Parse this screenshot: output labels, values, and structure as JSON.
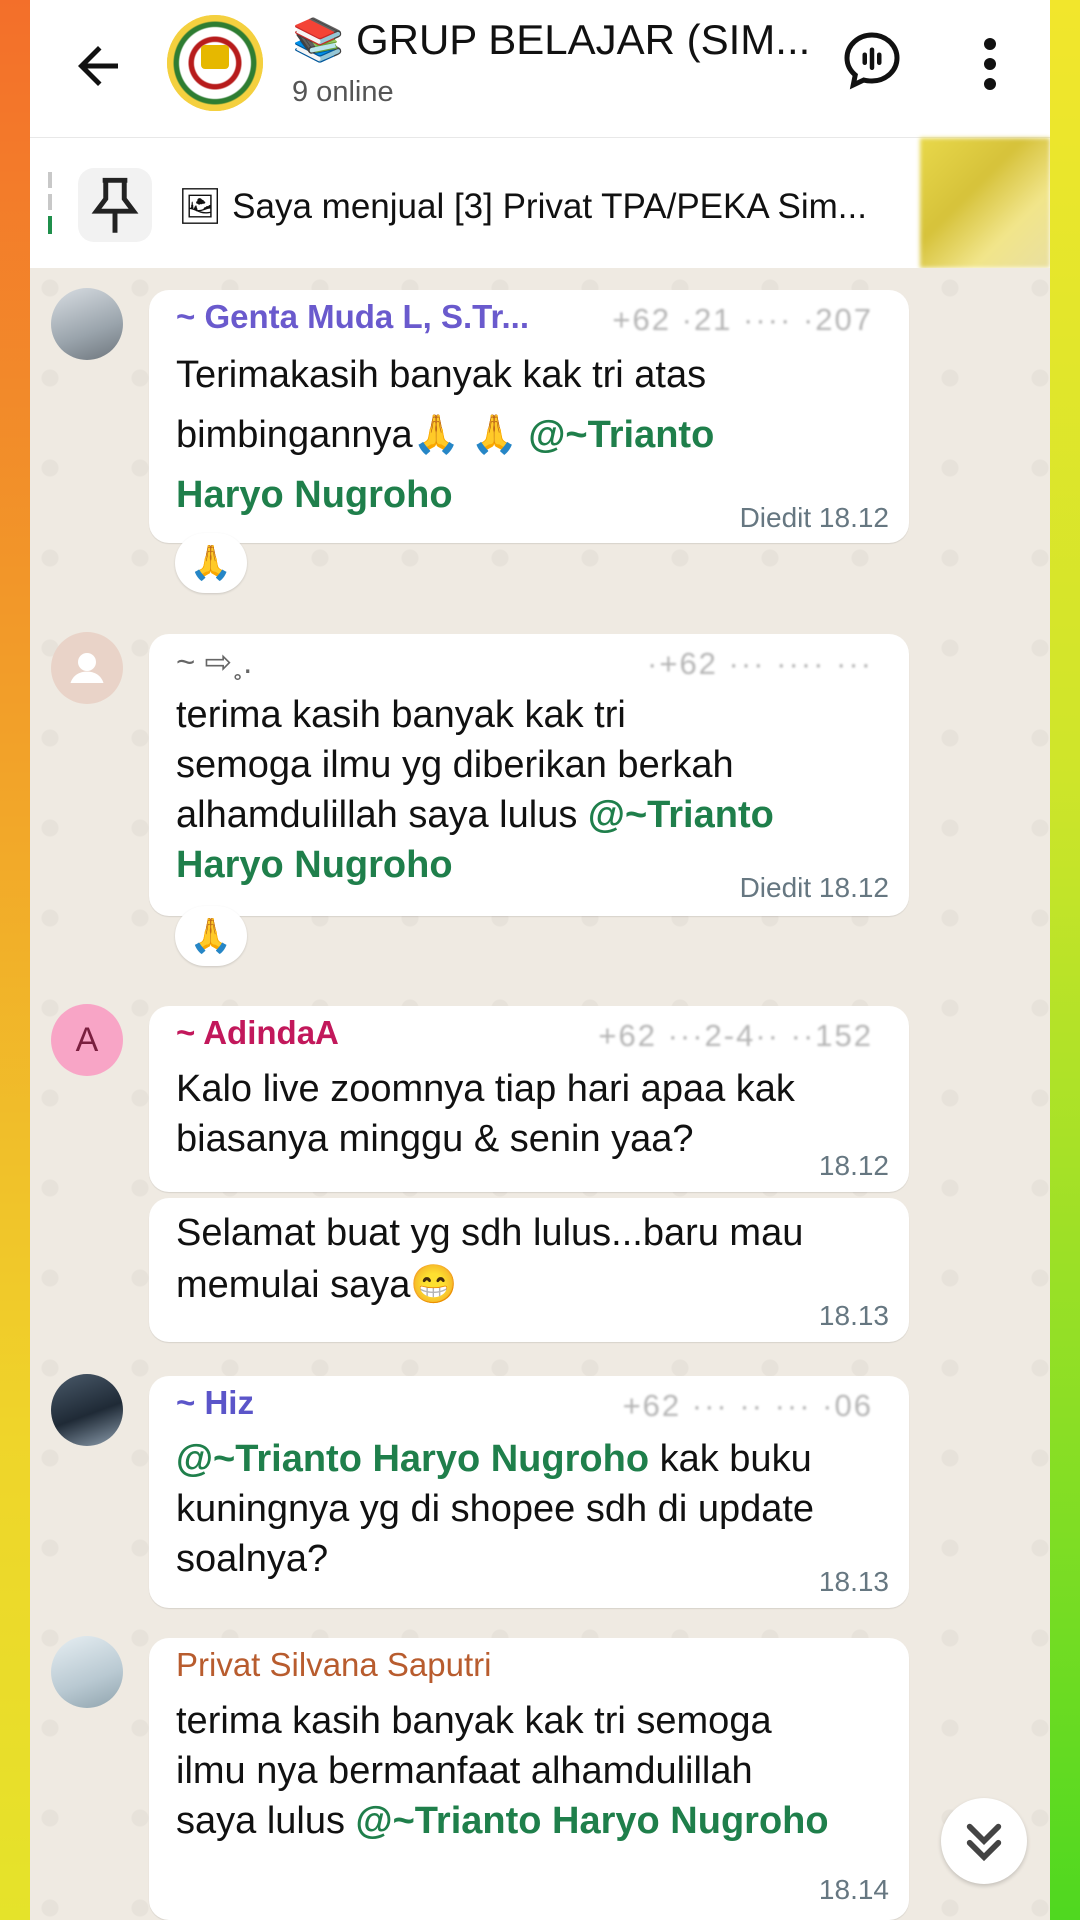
{
  "header": {
    "title": "📚 GRUP BELAJAR (SIM...",
    "status": "9 online"
  },
  "pinned": {
    "text": "🖼 Saya menjual [3] Privat TPA/PEKA Sim..."
  },
  "messages": [
    {
      "sender": "~ Genta Muda L, S.Tr...",
      "sender_color": "#6a5acd",
      "phone": "+62 ·21 ···· ·207",
      "lines": [
        "Terimakasih banyak kak tri atas",
        "bimbingannya🙏 🙏 "
      ],
      "mention_inline": "@~Trianto",
      "mention_line": "Haryo Nugroho",
      "time": "Diedit 18.12",
      "reaction": "🙏"
    },
    {
      "sender": "~ ⇨˳.",
      "sender_color": "#666666",
      "phone": "·+62 ··· ···· ···",
      "lines": [
        "terima kasih banyak kak tri",
        "semoga ilmu yg diberikan berkah",
        "alhamdulillah saya lulus "
      ],
      "mention_inline": "@~Trianto",
      "mention_line": "Haryo Nugroho",
      "time": "Diedit 18.12",
      "reaction": "🙏"
    },
    {
      "sender": "~ AdindaA",
      "sender_color": "#c2185b",
      "avatar_letter": "A",
      "phone": "+62 ···2-4·· ··152",
      "lines": [
        "Kalo live zoomnya tiap hari apaa kak",
        "biasanya minggu & senin yaa?"
      ],
      "time": "18.12"
    },
    {
      "lines": [
        "Selamat buat yg sdh lulus...baru mau",
        "memulai saya😁"
      ],
      "time": "18.13"
    },
    {
      "sender": "~ Hiz",
      "sender_color": "#5b55c9",
      "phone": "+62 ··· ·· ··· ·06",
      "mention_start": "@~Trianto Haryo Nugroho",
      "first_line_rest": " kak buku",
      "lines": [
        "kuningnya yg di shopee sdh di update",
        "soalnya?"
      ],
      "time": "18.13"
    },
    {
      "sender": "Privat Silvana Saputri",
      "sender_color": "#b85c2e",
      "lines": [
        "terima kasih banyak kak tri semoga",
        "ilmu nya bermanfaat alhamdulillah",
        "saya lulus "
      ],
      "mention_inline": "@~Trianto Haryo Nugroho",
      "time": "18.14"
    }
  ],
  "icons": {
    "back": "arrow-left-icon",
    "voice": "voice-chat-icon",
    "menu": "more-vert-icon",
    "pin": "pin-icon",
    "scroll": "double-chevron-down-icon"
  },
  "colors": {
    "chat_bg": "#efeae2",
    "mention": "#1f7f4b",
    "time": "#667781"
  }
}
